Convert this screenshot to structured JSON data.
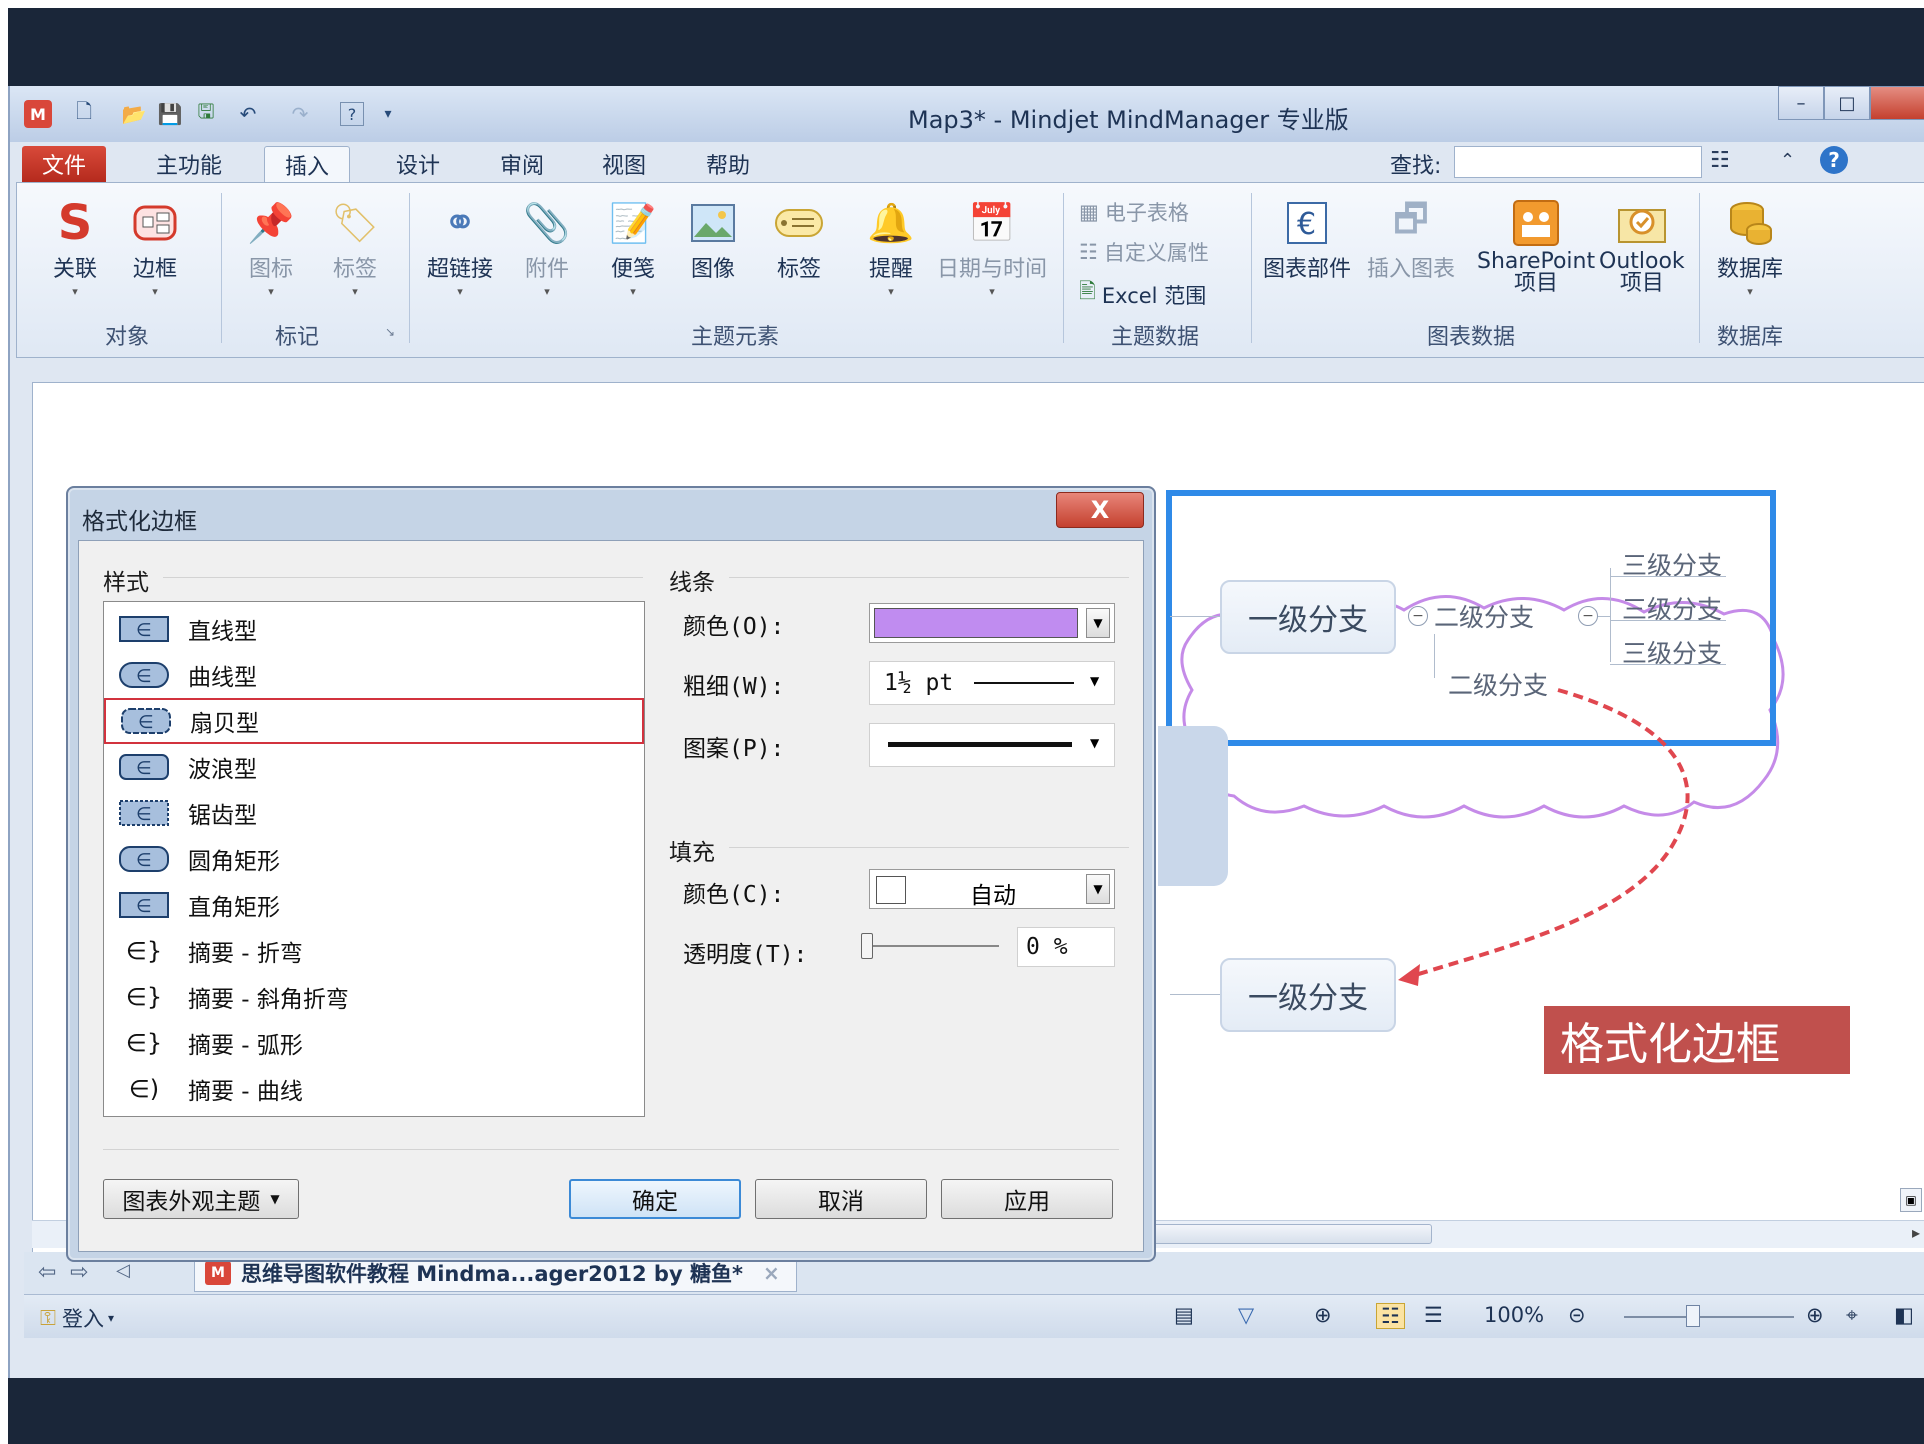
{
  "window": {
    "title": "Map3* - Mindjet MindManager 专业版",
    "minimize": "–",
    "maximize": "□"
  },
  "qat": {
    "app_icon": "M",
    "items": [
      "new-file-icon",
      "open-folder-icon",
      "save-icon",
      "save-all-icon",
      "undo-icon",
      "redo-icon",
      "help-icon",
      "customize-icon"
    ]
  },
  "tabs": [
    "文件",
    "主功能",
    "插入",
    "设计",
    "审阅",
    "视图",
    "帮助"
  ],
  "active_tab": "插入",
  "search": {
    "label": "查找:",
    "value": ""
  },
  "ribbon": {
    "groups": [
      {
        "label": "对象",
        "buttons": [
          "关联",
          "边框"
        ]
      },
      {
        "label": "标记",
        "buttons": [
          "图标",
          "标签"
        ]
      },
      {
        "label": "主题元素",
        "buttons": [
          "超链接",
          "附件",
          "便笺",
          "图像",
          "标签",
          "提醒",
          "日期与时间"
        ]
      },
      {
        "label": "主题数据",
        "buttons": [
          "电子表格",
          "自定义属性",
          "Excel 范围"
        ]
      },
      {
        "label": "图表数据",
        "buttons": [
          "图表部件",
          "插入图表",
          "SharePoint",
          "项目",
          "Outlook",
          "项目"
        ]
      },
      {
        "label": "数据库",
        "buttons": [
          "数据库"
        ]
      }
    ]
  },
  "map": {
    "level1_top": "一级分支",
    "level2_a": "二级分支",
    "level2_b": "二级分支",
    "level3": [
      "三级分支",
      "三级分支",
      "三级分支"
    ],
    "level1_bottom": "一级分支",
    "collapse_symbol": "−"
  },
  "overlay_label": "格式化边框",
  "dialog": {
    "title": "格式化边框",
    "close": "X",
    "style_section": "样式",
    "styles": [
      "直线型",
      "曲线型",
      "扇贝型",
      "波浪型",
      "锯齿型",
      "圆角矩形",
      "直角矩形",
      "摘要 - 折弯",
      "摘要 - 斜角折弯",
      "摘要 - 弧形",
      "摘要 - 曲线"
    ],
    "selected_style": "扇贝型",
    "line_section": "线条",
    "line_color_label": "颜色(O):",
    "line_color": "#c08cf0",
    "line_weight_label": "粗细(W):",
    "line_weight_value": "1½ pt",
    "line_pattern_label": "图案(P):",
    "fill_section": "填充",
    "fill_color_label": "颜色(C):",
    "fill_color_value": "自动",
    "transparency_label": "透明度(T):",
    "transparency_value": "0 %",
    "theme_button": "图表外观主题",
    "ok": "确定",
    "cancel": "取消",
    "apply": "应用"
  },
  "doc_tab": {
    "title": "思维导图软件教程 Mindma...ager2012 by 糖鱼*",
    "close": "×"
  },
  "status": {
    "login": "登入",
    "zoom": "100%"
  },
  "colors": {
    "file_tab": "#c93a2b",
    "boundary": "#2f8ae8",
    "scallop": "#c58be8",
    "relation": "#e0474f",
    "label_bg": "#c0504d"
  }
}
